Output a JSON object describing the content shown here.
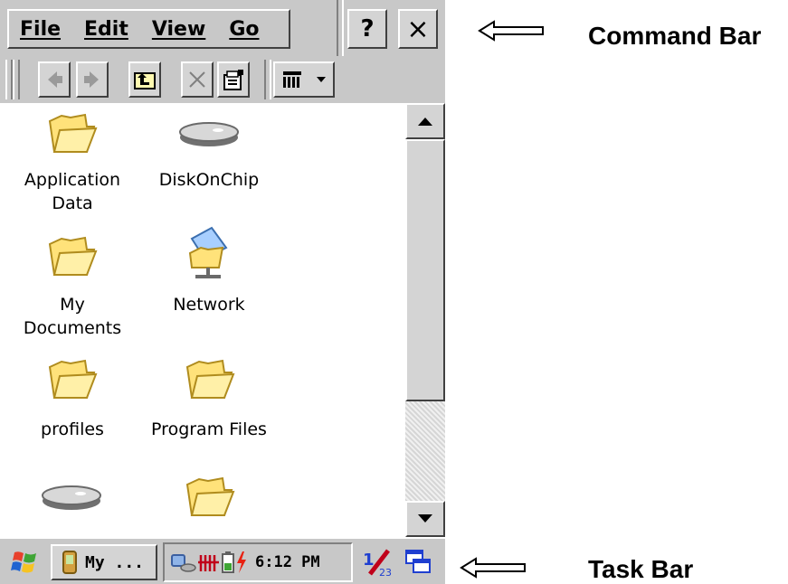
{
  "menu": {
    "items": [
      "File",
      "Edit",
      "View",
      "Go"
    ],
    "help_label": "?",
    "close_label": "×"
  },
  "toolbar": {
    "buttons": [
      "back-arrow-icon",
      "forward-arrow-icon",
      "folder-up-icon",
      "delete-icon",
      "properties-icon",
      "view-menu-icon"
    ]
  },
  "files": [
    {
      "name": "Application\nData",
      "icon": "folder-icon"
    },
    {
      "name": "DiskOnChip",
      "icon": "drive-icon"
    },
    {
      "name": "My\nDocuments",
      "icon": "folder-icon"
    },
    {
      "name": "Network",
      "icon": "network-icon"
    },
    {
      "name": "profiles",
      "icon": "folder-icon"
    },
    {
      "name": "Program Files",
      "icon": "folder-icon"
    },
    {
      "name": "",
      "icon": "drive-icon"
    },
    {
      "name": "",
      "icon": "folder-icon"
    }
  ],
  "taskbar": {
    "start_icon": "windows-flag-icon",
    "task_label": "My ...",
    "clock": "6:12 PM"
  },
  "annotations": {
    "command_bar": "Command Bar",
    "task_bar": "Task Bar"
  }
}
